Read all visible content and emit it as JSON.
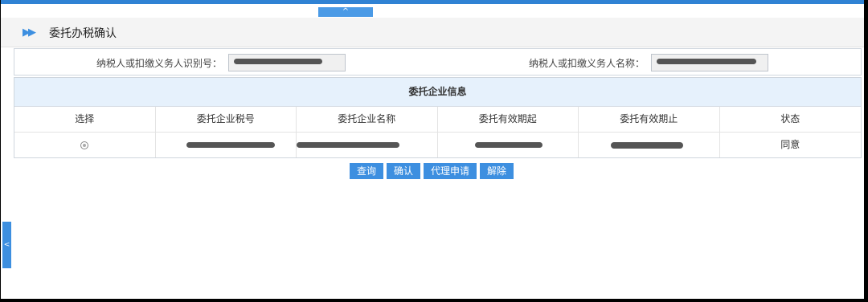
{
  "collapse_tab": {
    "glyph": "^"
  },
  "header": {
    "arrow": "▶▶",
    "title": "委托办税确认"
  },
  "search": {
    "id_label": "纳税人或扣缴义务人识别号：",
    "name_label": "纳税人或扣缴义务人名称："
  },
  "grid": {
    "title": "委托企业信息",
    "columns": [
      "选择",
      "委托企业税号",
      "委托企业名称",
      "委托有效期起",
      "委托有效期止",
      "状态"
    ],
    "rows": [
      {
        "status": "同意"
      }
    ]
  },
  "buttons": {
    "query": "查询",
    "confirm": "确认",
    "agent_apply": "代理申请",
    "release": "解除"
  },
  "sidetab": {
    "glyph": "<"
  }
}
